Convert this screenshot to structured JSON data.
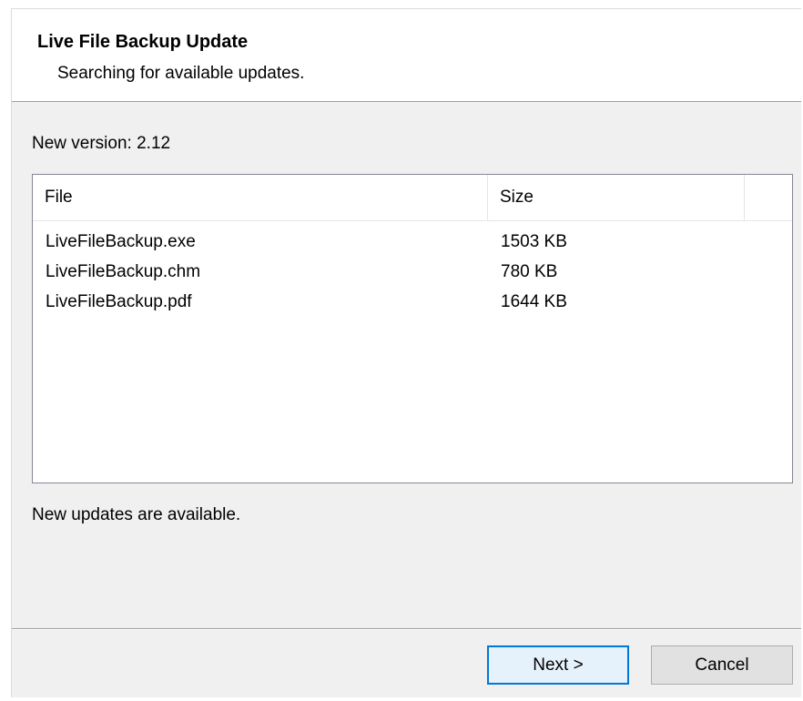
{
  "header": {
    "title": "Live File Backup Update",
    "subtitle": "Searching for available updates."
  },
  "version": {
    "label": "New version: 2.12"
  },
  "file_list": {
    "columns": [
      "File",
      "Size"
    ],
    "rows": [
      {
        "name": "LiveFileBackup.exe",
        "size": "1503 KB"
      },
      {
        "name": "LiveFileBackup.chm",
        "size": "780 KB"
      },
      {
        "name": "LiveFileBackup.pdf",
        "size": "1644 KB"
      }
    ]
  },
  "status": {
    "text": "New updates are available."
  },
  "buttons": {
    "next_label": "Next >",
    "cancel_label": "Cancel"
  },
  "colors": {
    "accent": "#0078d7",
    "dialog_bg": "#f0f0f0",
    "header_bg": "#ffffff"
  }
}
